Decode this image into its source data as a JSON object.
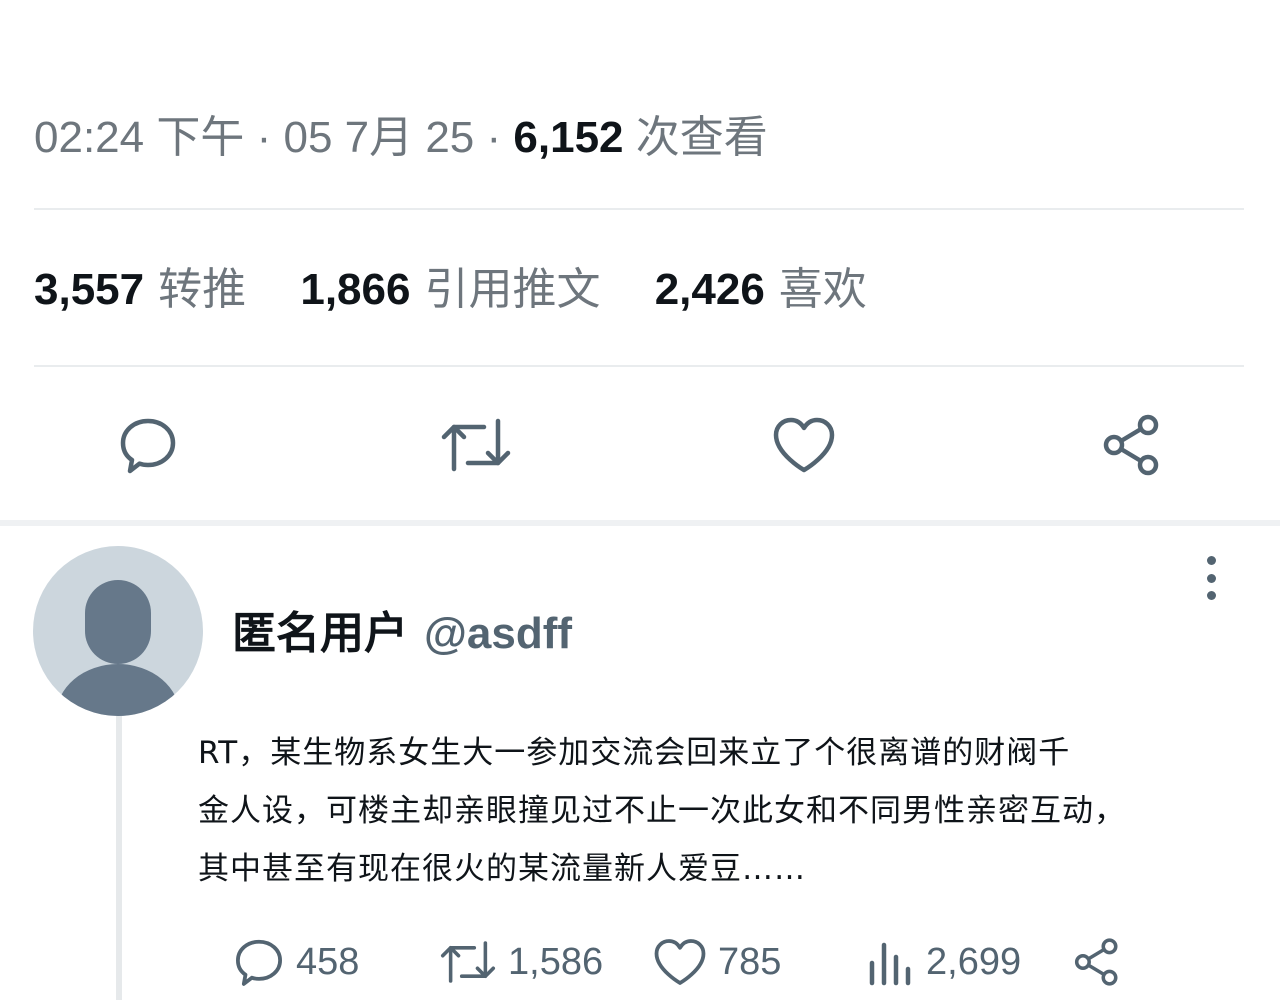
{
  "meta": {
    "time": "02:24 下午",
    "date": "05 7月 25",
    "views_count": "6,152",
    "views_label": "次查看",
    "separator": "·"
  },
  "stats": {
    "retweets": {
      "count": "3,557",
      "label": "转推"
    },
    "quotes": {
      "count": "1,866",
      "label": "引用推文"
    },
    "likes": {
      "count": "2,426",
      "label": "喜欢"
    }
  },
  "reply": {
    "display_name": "匿名用户",
    "handle": "@asdff",
    "text_lines": [
      "RT，某生物系女生大一参加交流会回来立了个很离谱的财阀千",
      "金人设，可楼主却亲眼撞见过不止一次此女和不同男性亲密互动，",
      "其中甚至有现在很火的某流量新人爱豆……"
    ],
    "counts": {
      "replies": "458",
      "retweets": "1,586",
      "likes": "785",
      "views": "2,699"
    }
  },
  "icons": {
    "action_bar": [
      "reply-icon",
      "retweet-icon",
      "like-icon",
      "share-icon"
    ],
    "reply_actions": [
      "reply-icon",
      "retweet-icon",
      "like-icon",
      "views-icon",
      "share-icon"
    ]
  },
  "colors": {
    "text_primary": "#0f1419",
    "text_secondary": "#6e767d",
    "icon": "#536471",
    "avatar_bg": "#ccd6dd",
    "avatar_fg": "#66788a"
  }
}
